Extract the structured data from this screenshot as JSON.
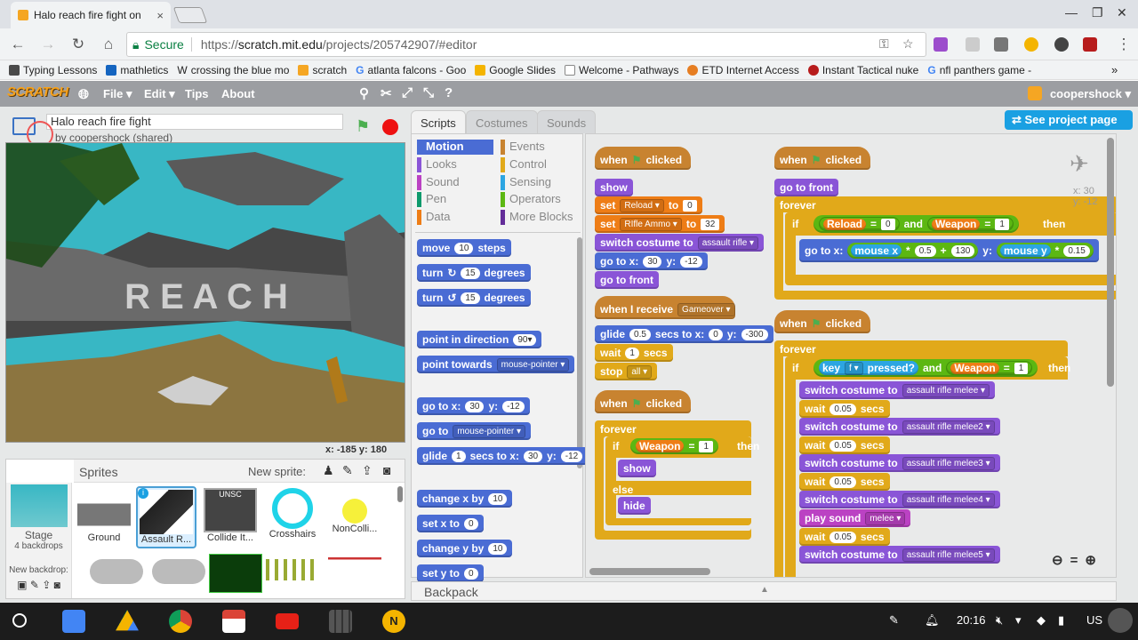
{
  "browser": {
    "tab_title": "Halo reach fire fight on",
    "tab_close": "×",
    "win_min": "—",
    "win_max": "❐",
    "win_close": "✕",
    "secure_label": "Secure",
    "url_scheme": "https://",
    "url_host": "scratch.mit.edu",
    "url_path": "/projects/205742907/#editor",
    "bookmarks": [
      "Typing Lessons",
      "mathletics",
      "crossing the blue mo",
      "scratch",
      "atlanta falcons - Goo",
      "Google Slides",
      "Welcome - Pathways",
      "ETD Internet Access",
      "Instant Tactical nuke",
      "nfl panthers game -"
    ],
    "bookmark_more": "»"
  },
  "scratch": {
    "logo": "SCRATCH",
    "menus": [
      "File ▾",
      "Edit ▾",
      "Tips",
      "About"
    ],
    "username": "coopershock ▾",
    "project_title": "Halo reach fire fight",
    "byline": "by coopershock (shared)",
    "stage_text": "R E A C H",
    "mouse_coords": "x: -185  y: 180",
    "see_project": "See project page",
    "tabs": [
      "Scripts",
      "Costumes",
      "Sounds"
    ],
    "sprites_header": "Sprites",
    "new_sprite": "New sprite:",
    "stage_label": "Stage",
    "stage_backdrops": "4 backdrops",
    "new_backdrop": "New backdrop:",
    "sprites": [
      "Ground",
      "Assault R...",
      "Collide It...",
      "Crosshairs",
      "NonColli..."
    ],
    "unsc_label": "UNSC",
    "sprite_xy": [
      "x: 30",
      "y: -12"
    ],
    "backpack": "Backpack"
  },
  "categories": {
    "left": [
      "Motion",
      "Looks",
      "Sound",
      "Pen",
      "Data"
    ],
    "right": [
      "Events",
      "Control",
      "Sensing",
      "Operators",
      "More Blocks"
    ]
  },
  "palette": {
    "move": "move",
    "move_n": "10",
    "steps": "steps",
    "turn": "turn",
    "turn_cw": "↻",
    "turn_ccw": "↺",
    "deg15": "15",
    "degrees": "degrees",
    "point_dir": "point in direction",
    "dir90": "90▾",
    "point_towards": "point towards",
    "mouse_pointer": "mouse-pointer ▾",
    "goto_xy": "go to x:",
    "gx": "30",
    "y": "y:",
    "gy": "-12",
    "goto": "go to",
    "glide": "glide",
    "g1": "1",
    "secs_to_x": "secs to x:",
    "change_x": "change x by",
    "cx": "10",
    "set_x": "set x to",
    "sx": "0",
    "change_y": "change y by",
    "cy": "10",
    "set_y": "set y to",
    "sy": "0"
  },
  "scripts": {
    "when": "when",
    "clicked": "clicked",
    "show": "show",
    "set": "set",
    "reload": "Reload ▾",
    "to": "to",
    "zero": "0",
    "rifle_ammo": "RIfle Ammo ▾",
    "ammo_val": "32",
    "switch_costume": "switch costume to",
    "assault_rifle": "assault rifle ▾",
    "goto_xy": "go to x:",
    "x30": "30",
    "y": "y:",
    "ym12": "-12",
    "go_front": "go to front",
    "when_receive": "when I receive",
    "gameover": "Gameover ▾",
    "glide": "glide",
    "g05": "0.5",
    "secs_to_x": "secs to x:",
    "gx0": "0",
    "gym300": "-300",
    "wait": "wait",
    "w1": "1",
    "secs": "secs",
    "stop": "stop",
    "all": "all ▾",
    "forever": "forever",
    "if": "if",
    "else": "else",
    "then": "then",
    "hide": "hide",
    "weapon": "Weapon",
    "eq": "=",
    "one": "1",
    "and": "and",
    "reload_r": "Reload",
    "mouse_x": "mouse x",
    "mouse_y": "mouse y",
    "mul": "*",
    "plus": "+",
    "f05": "0.5",
    "v130": "130",
    "f015": "0.15",
    "key": "key",
    "f": "f ▾",
    "pressed": "pressed?",
    "melee": "assault rifle melee ▾",
    "melee2": "assault rifle melee2 ▾",
    "melee3": "assault rifle melee3 ▾",
    "melee4": "assault rifle melee4 ▾",
    "melee5": "assault rifle melee5 ▾",
    "w005": "0.05",
    "play_sound": "play sound",
    "melee_snd": "melee ▾"
  },
  "taskbar": {
    "time": "20:16",
    "locale": "US",
    "keep_badge": "N"
  },
  "colors": {
    "motion": "#4a6cd4",
    "looks": "#8a55d7",
    "sound": "#bb42c3",
    "events": "#c88330",
    "control": "#e1a91a",
    "operators": "#5cb712",
    "sensing": "#2ca5e2",
    "data": "#ee7d16"
  }
}
